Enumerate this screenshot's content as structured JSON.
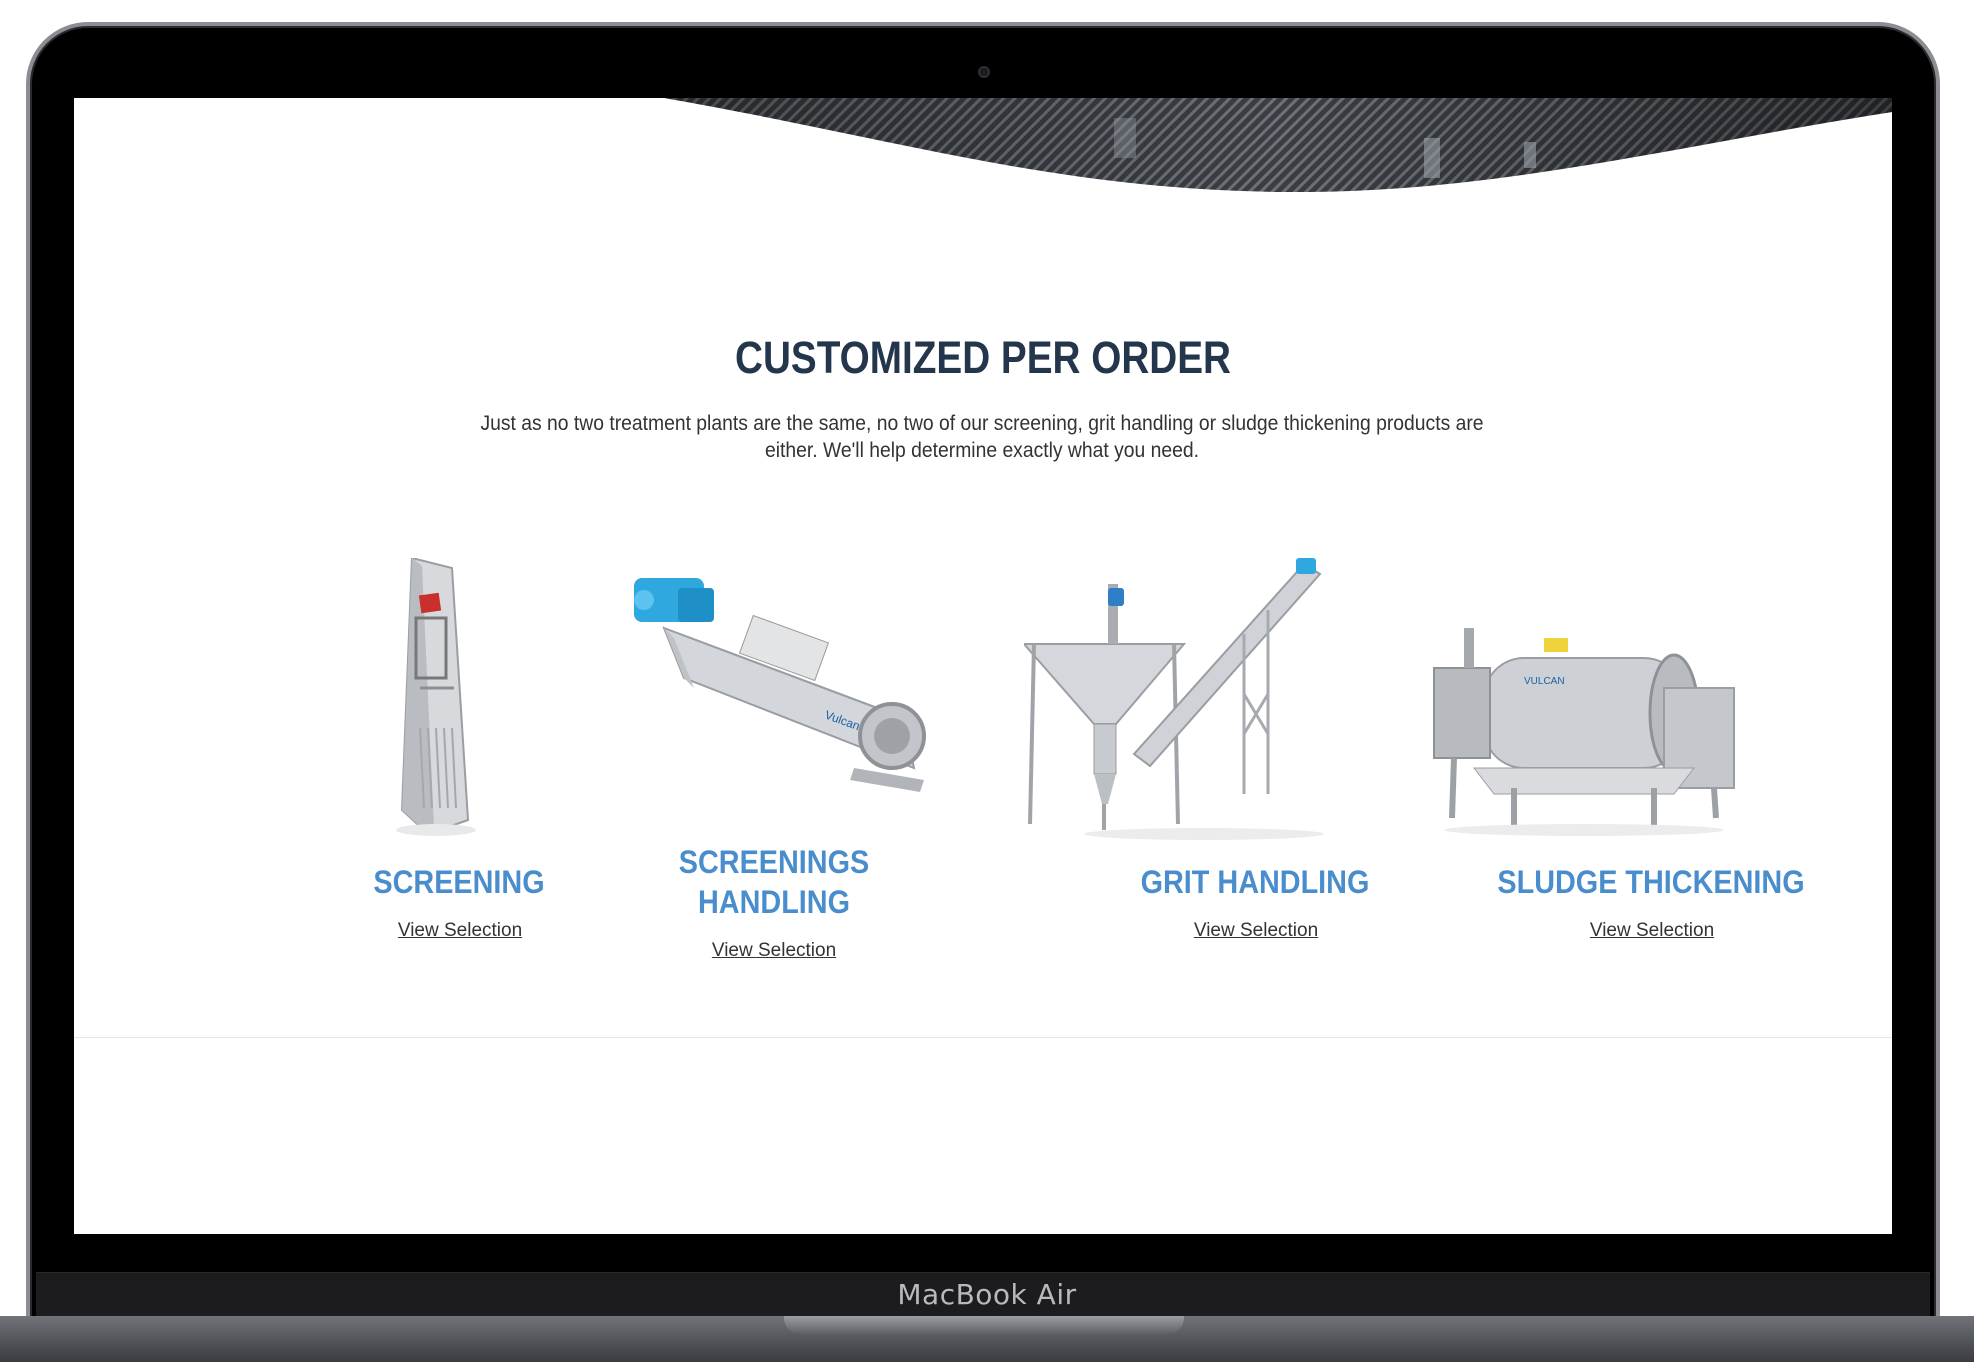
{
  "device": {
    "model_label": "MacBook Air"
  },
  "section": {
    "title": "CUSTOMIZED PER ORDER",
    "intro": "Just as no two treatment plants are the same, no two of our screening, grit handling or sludge thickening products are either. We'll help determine exactly what you need."
  },
  "products": [
    {
      "name": "SCREENING",
      "link": "View Selection",
      "icon": "screening-machine-image"
    },
    {
      "name_lines": [
        "SCREENINGS",
        "HANDLING"
      ],
      "link": "View Selection",
      "icon": "screw-conveyor-image"
    },
    {
      "name": "GRIT HANDLING",
      "link": "View Selection",
      "icon": "grit-classifier-image"
    },
    {
      "name": "SLUDGE THICKENING",
      "link": "View Selection",
      "icon": "drum-thickener-image"
    }
  ],
  "colors": {
    "title": "#24364c",
    "product_name": "#4a8dcc",
    "accent_blue_equipment": "#2fa8e0",
    "steel": "#c9ccd0"
  }
}
